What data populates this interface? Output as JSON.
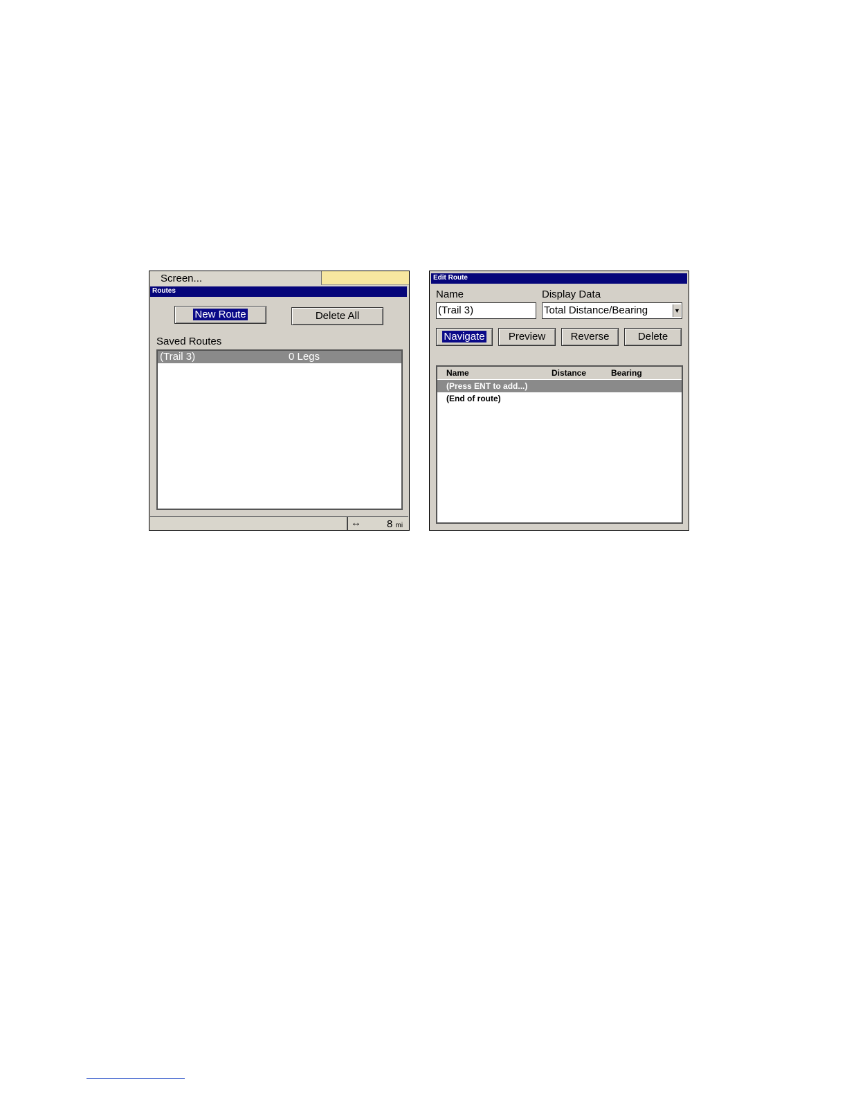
{
  "left_screen": {
    "menu_label": "Screen...",
    "title": "Routes",
    "new_route_label": "New Route",
    "delete_all_label": "Delete All",
    "saved_routes_label": "Saved Routes",
    "routes": [
      {
        "name": "(Trail 3)",
        "legs": "0 Legs"
      }
    ],
    "status": {
      "scale_value": "8",
      "scale_unit": "mi",
      "arrow_icon": "↔"
    }
  },
  "right_screen": {
    "title": "Edit Route",
    "name_label": "Name",
    "name_value": "(Trail 3)",
    "display_data_label": "Display Data",
    "display_data_value": "Total Distance/Bearing",
    "buttons": {
      "navigate": "Navigate",
      "preview": "Preview",
      "reverse": "Reverse",
      "delete": "Delete"
    },
    "columns": [
      "Name",
      "Distance",
      "Bearing"
    ],
    "rows": [
      "(Press ENT to add...)",
      "(End of route)"
    ]
  },
  "colors": {
    "title_bar": "#05057a",
    "selection": "#8a8a8a",
    "panel": "#d4d0c8"
  }
}
